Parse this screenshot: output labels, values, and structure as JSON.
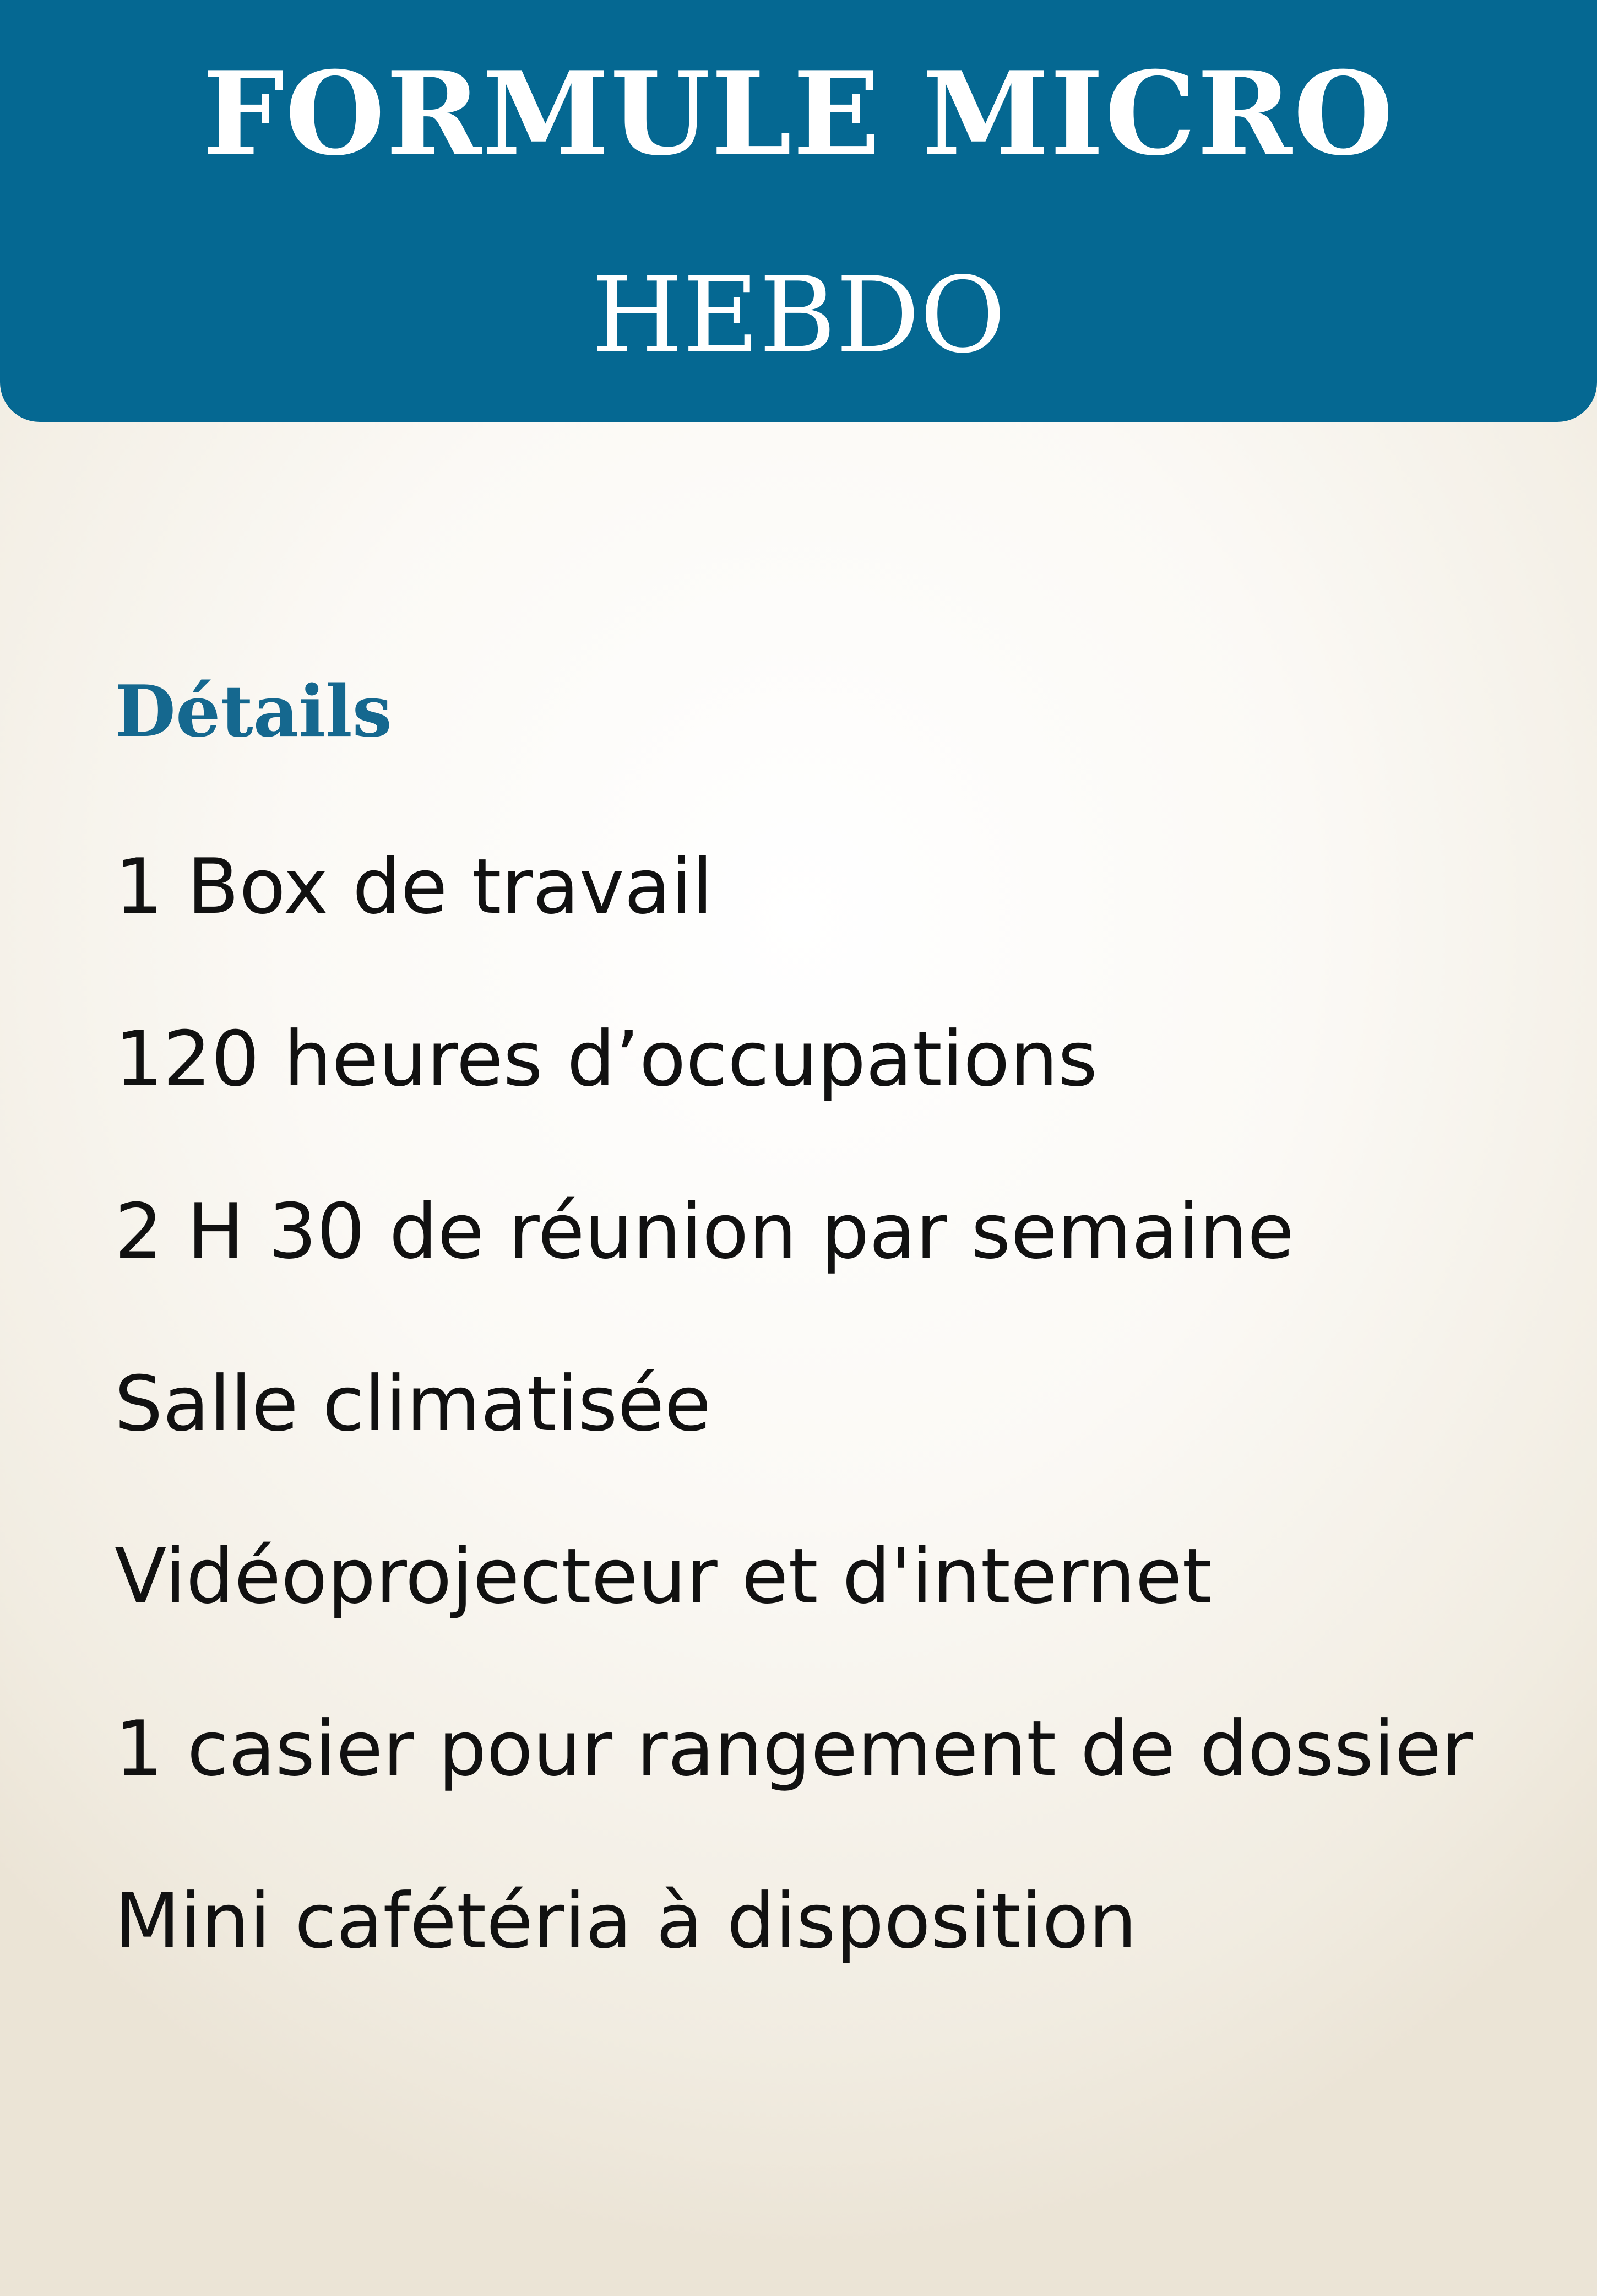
{
  "header": {
    "title": "FORMULE MICRO",
    "subtitle": "HEBDO"
  },
  "section": {
    "title": "Détails"
  },
  "details": [
    "1 Box de travail",
    "120 heures d’occupations",
    "2 H 30 de réunion par semaine",
    "Salle climatisée",
    "Vidéoprojecteur et d'internet",
    "1 casier pour rangement de dossier",
    "Mini cafétéria à disposition"
  ],
  "colors": {
    "header_background": "#056892",
    "section_title": "#15688f",
    "body_text": "#111111",
    "background_center": "#ffffff",
    "background_edge": "#ebe4d6"
  }
}
